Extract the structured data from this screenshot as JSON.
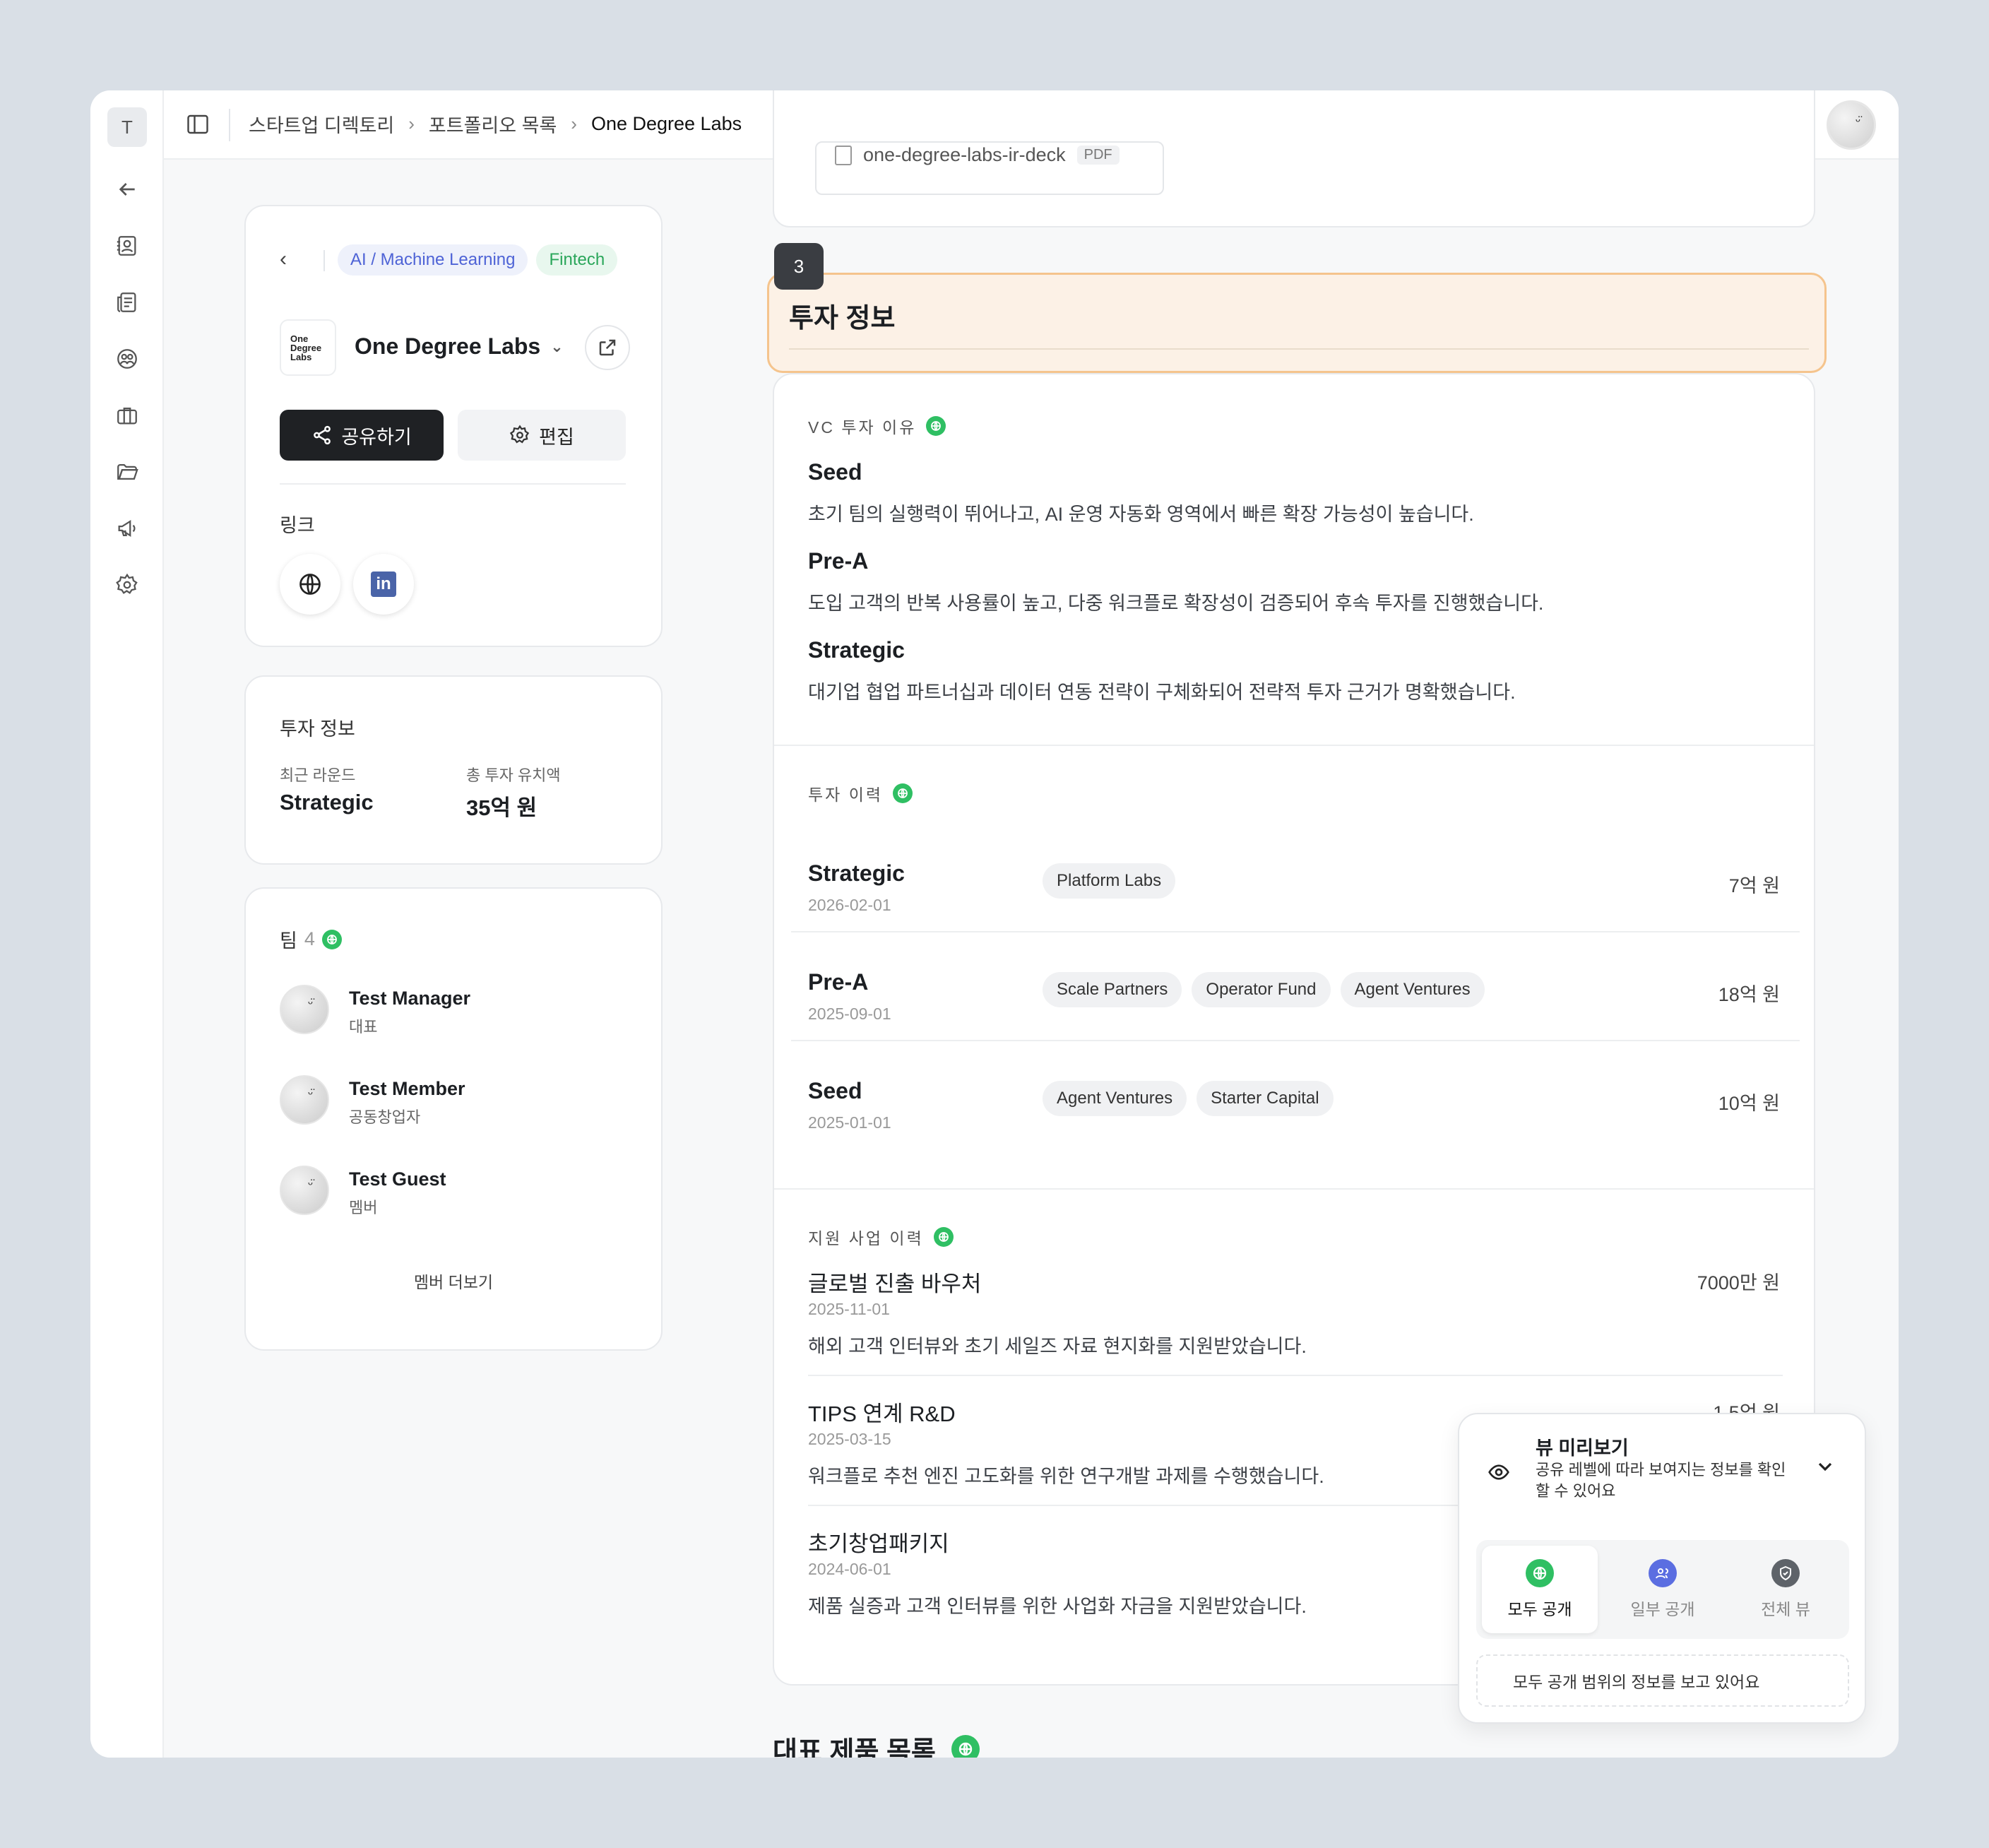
{
  "rail": {
    "workspace": "T",
    "icons": [
      "back-arrow-icon",
      "contacts-icon",
      "news-icon",
      "users-circle-icon",
      "briefcase-icon",
      "folder-icon",
      "megaphone-icon",
      "gear-icon"
    ]
  },
  "breadcrumb": {
    "items": [
      "스타트업 디렉토리",
      "포트폴리오 목록",
      "One Degree Labs"
    ]
  },
  "company": {
    "tags": [
      "AI / Machine Learning",
      "Fintech"
    ],
    "logo_text": "One Degree Labs",
    "name": "One Degree Labs",
    "share_label": "공유하기",
    "edit_label": "편집",
    "links_title": "링크"
  },
  "invest_summary": {
    "title": "투자 정보",
    "recent_round_label": "최근 라운드",
    "recent_round_value": "Strategic",
    "total_label": "총 투자 유치액",
    "total_value": "35억 원"
  },
  "team": {
    "title": "팀",
    "count": "4",
    "members": [
      {
        "name": "Test Manager",
        "role": "대표"
      },
      {
        "name": "Test Member",
        "role": "공동창업자"
      },
      {
        "name": "Test Guest",
        "role": "멤버"
      }
    ],
    "more_label": "멤버 더보기"
  },
  "top_file": {
    "name": "one-degree-labs-ir-deck",
    "ext": "PDF"
  },
  "section": {
    "number": "3",
    "title": "투자 정보"
  },
  "vc_reasons": {
    "label": "VC 투자 이유",
    "items": [
      {
        "round": "Seed",
        "text": "초기 팀의 실행력이 뛰어나고, AI 운영 자동화 영역에서 빠른 확장 가능성이 높습니다."
      },
      {
        "round": "Pre-A",
        "text": "도입 고객의 반복 사용률이 높고, 다중 워크플로 확장성이 검증되어 후속 투자를 진행했습니다."
      },
      {
        "round": "Strategic",
        "text": "대기업 협업 파트너십과 데이터 연동 전략이 구체화되어 전략적 투자 근거가 명확했습니다."
      }
    ]
  },
  "history": {
    "label": "투자 이력",
    "rows": [
      {
        "round": "Strategic",
        "date": "2026-02-01",
        "investors": [
          "Platform Labs"
        ],
        "amount": "7억 원"
      },
      {
        "round": "Pre-A",
        "date": "2025-09-01",
        "investors": [
          "Scale Partners",
          "Operator Fund",
          "Agent Ventures"
        ],
        "amount": "18억 원"
      },
      {
        "round": "Seed",
        "date": "2025-01-01",
        "investors": [
          "Agent Ventures",
          "Starter Capital"
        ],
        "amount": "10억 원"
      }
    ]
  },
  "grants": {
    "label": "지원 사업 이력",
    "items": [
      {
        "title": "글로벌 진출 바우처",
        "date": "2025-11-01",
        "text": "해외 고객 인터뷰와 초기 세일즈 자료 현지화를 지원받았습니다.",
        "amount": "7000만 원"
      },
      {
        "title": "TIPS 연계 R&D",
        "date": "2025-03-15",
        "text": "워크플로 추천 엔진 고도화를 위한 연구개발 과제를 수행했습니다.",
        "amount": "1.5억 원"
      },
      {
        "title": "초기창업패키지",
        "date": "2024-06-01",
        "text": "제품 실증과 고객 인터뷰를 위한 사업화 자금을 지원받았습니다.",
        "amount": ""
      }
    ]
  },
  "products": {
    "title": "대표 제품 목록"
  },
  "preview": {
    "title": "뷰 미리보기",
    "desc": "공유 레벨에 따라 보여지는 정보를 확인할 수 있어요",
    "options": [
      "모두 공개",
      "일부 공개",
      "전체 뷰"
    ],
    "selected": "모두 공개",
    "status": "모두 공개 범위의 정보를 보고 있어요"
  },
  "colors": {
    "green": "#2fbf63",
    "blue": "#5b6ee1",
    "section_bg": "#fcf1e6",
    "section_border": "#f5c48d"
  }
}
